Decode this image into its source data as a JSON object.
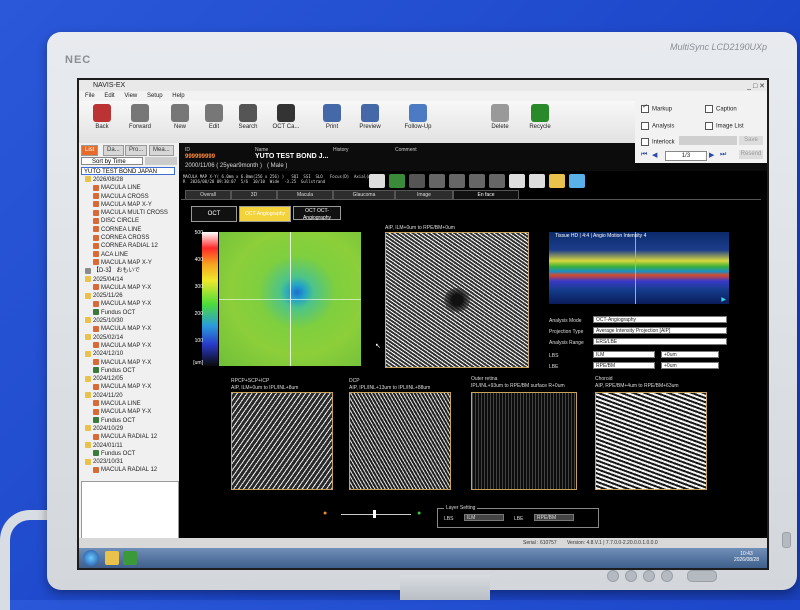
{
  "monitor": {
    "brand": "NEC",
    "model": "MultiSync LCD2190UXp"
  },
  "window": {
    "title": "NAVIS-EX",
    "controls": "_ □ ✕"
  },
  "menu": [
    "File",
    "Edit",
    "View",
    "Setup",
    "Help"
  ],
  "toolbar": [
    {
      "label": "Back",
      "icon": "back-icon",
      "color": "#b33"
    },
    {
      "label": "Forward",
      "icon": "forward-icon",
      "color": "#777"
    },
    {
      "label": "New",
      "icon": "new-icon",
      "color": "#777"
    },
    {
      "label": "Edit",
      "icon": "edit-icon",
      "color": "#777"
    },
    {
      "label": "Search",
      "icon": "search-icon",
      "color": "#555"
    },
    {
      "label": "OCT Ca...",
      "icon": "oct-capture-icon",
      "color": "#333"
    },
    {
      "label": "Print",
      "icon": "print-icon",
      "color": "#4468a8"
    },
    {
      "label": "Preview",
      "icon": "preview-icon",
      "color": "#4468a8"
    },
    {
      "label": "Follow-Up",
      "icon": "follow-up-icon",
      "color": "#4c7bc4"
    },
    {
      "label": "Delete",
      "icon": "delete-icon",
      "color": "#999"
    },
    {
      "label": "Recycle",
      "icon": "recycle-icon",
      "color": "#2a8a2a"
    }
  ],
  "right_panel": {
    "markup": "Markup",
    "caption": "Caption",
    "analysis": "Analysis",
    "image_list": "Image List",
    "interlock": "Interlock",
    "page": "1/3",
    "save": "Save",
    "resend": "Resend"
  },
  "left_tabs": [
    "List",
    "Da...",
    "Pro...",
    "Mea..."
  ],
  "sort": "Sort by Time",
  "patient_header": "YUTO TEST BOND JAPAN",
  "tree": [
    {
      "text": "2026/08/28",
      "kind": "folder"
    },
    {
      "text": "MACULA LINE",
      "kind": "scan"
    },
    {
      "text": "MACULA CROSS",
      "kind": "scan"
    },
    {
      "text": "MACULA MAP X-Y",
      "kind": "scan"
    },
    {
      "text": "MACULA MULTI CROSS",
      "kind": "scan"
    },
    {
      "text": "DISC CIRCLE",
      "kind": "scan"
    },
    {
      "text": "CORNEA LINE",
      "kind": "scan"
    },
    {
      "text": "CORNEA CROSS",
      "kind": "scan"
    },
    {
      "text": "CORNEA RADIAL 12",
      "kind": "scan"
    },
    {
      "text": "ACA LINE",
      "kind": "scan"
    },
    {
      "text": "MACULA MAP X-Y",
      "kind": "scan"
    },
    {
      "text": "【D-3】 おもいで",
      "kind": "group"
    },
    {
      "text": "2025/04/14",
      "kind": "folder"
    },
    {
      "text": "MACULA MAP Y-X",
      "kind": "scan"
    },
    {
      "text": "2025/11/26",
      "kind": "folder"
    },
    {
      "text": "MACULA MAP Y-X",
      "kind": "scan"
    },
    {
      "text": "Fundus OCT",
      "kind": "fundus"
    },
    {
      "text": "2025/10/30",
      "kind": "folder"
    },
    {
      "text": "MACULA MAP Y-X",
      "kind": "scan"
    },
    {
      "text": "2025/02/14",
      "kind": "folder"
    },
    {
      "text": "MACULA MAP Y-X",
      "kind": "scan"
    },
    {
      "text": "2024/12/10",
      "kind": "folder"
    },
    {
      "text": "MACULA MAP Y-X",
      "kind": "scan"
    },
    {
      "text": "Fundus OCT",
      "kind": "fundus"
    },
    {
      "text": "2024/12/05",
      "kind": "folder"
    },
    {
      "text": "MACULA MAP Y-X",
      "kind": "scan"
    },
    {
      "text": "2024/11/20",
      "kind": "folder"
    },
    {
      "text": "MACULA LINE",
      "kind": "scan"
    },
    {
      "text": "MACULA MAP Y-X",
      "kind": "scan"
    },
    {
      "text": "Fundus OCT",
      "kind": "fundus"
    },
    {
      "text": "2024/10/29",
      "kind": "folder"
    },
    {
      "text": "MACULA RADIAL 12",
      "kind": "scan"
    },
    {
      "text": "2024/01/11",
      "kind": "folder"
    },
    {
      "text": "Fundus OCT",
      "kind": "fundus"
    },
    {
      "text": "2023/10/31",
      "kind": "folder"
    },
    {
      "text": "MACULA RADIAL 12",
      "kind": "scan"
    }
  ],
  "patient": {
    "id_label": "ID",
    "id": "999999999",
    "name_label": "Name",
    "name": "YUTO TEST BOND J...",
    "history_label": "History",
    "comment_label": "Comment",
    "dob": "2000/11/06 ( 25year9month )",
    "sex": "( Male )"
  },
  "scan_info": {
    "line1": "MACULA MAP X-Y( 6.0mm x 6.0mm(256 x 256) )   SQI  SSI  SLO   Focus(D)  Axial(mm)",
    "line2": "R  2026/08/28 09:30:07  5/6  10/10  Wide  -3.25  Gullstrand"
  },
  "tabs": [
    "Overall",
    "3D",
    "Macula",
    "Glaucoma",
    "Image",
    "En face"
  ],
  "active_tab": "En face",
  "mode_buttons": [
    "OCT",
    "OCT-Angiography",
    "OCT OCT-Angiography"
  ],
  "thickness_scale": {
    "values": [
      "500",
      "400",
      "300",
      "200",
      "100"
    ],
    "unit": "[um]"
  },
  "image_labels": {
    "main_angio": "AIP, ILM+0um to RPE/BM+0um",
    "bscan": "Tissue HD | 4:4 | Angio Motion Intensity 4",
    "rpcp_title": "RPCP+SCP+ICP",
    "rpcp": "AIP, ILM+0um to IPL/INL+8um",
    "dcp_title": "DCP",
    "dcp": "AIP, IPL/INL+13um to IPL/INL+88um",
    "outer_title": "Outer retina",
    "outer": "IPL/INL+93um to RPE/BM surface R+0um",
    "choroid_title": "Choroid",
    "choroid": "AIP, RPE/BM+4um to RPE/BM+63um"
  },
  "analysis": {
    "mode_label": "Analysis Mode",
    "mode": "OCT-Angiography",
    "proj_label": "Projection Type",
    "proj": "Average Intensity Projection [AIP]",
    "range_label": "Analysis Range",
    "range": "ERS/LBE",
    "lbs_label": "LBS",
    "lbs": "ILM",
    "lbs_off": "+0um",
    "lbe_label": "LBE",
    "lbe": "RPE/BM",
    "lbe_off": "+0um"
  },
  "layer_setting": {
    "title": "Layer Setting",
    "lbs_label": "LBS",
    "lbs": "ILM",
    "lbe_label": "LBE",
    "lbe": "RPE/BM"
  },
  "status": {
    "serial": "Serial : 610757",
    "version": "Version: 4.8.V.1 | 7.7.0.0-2.20.0.0.1.0.0.0",
    "time": "10:43",
    "date": "2026/08/28"
  }
}
